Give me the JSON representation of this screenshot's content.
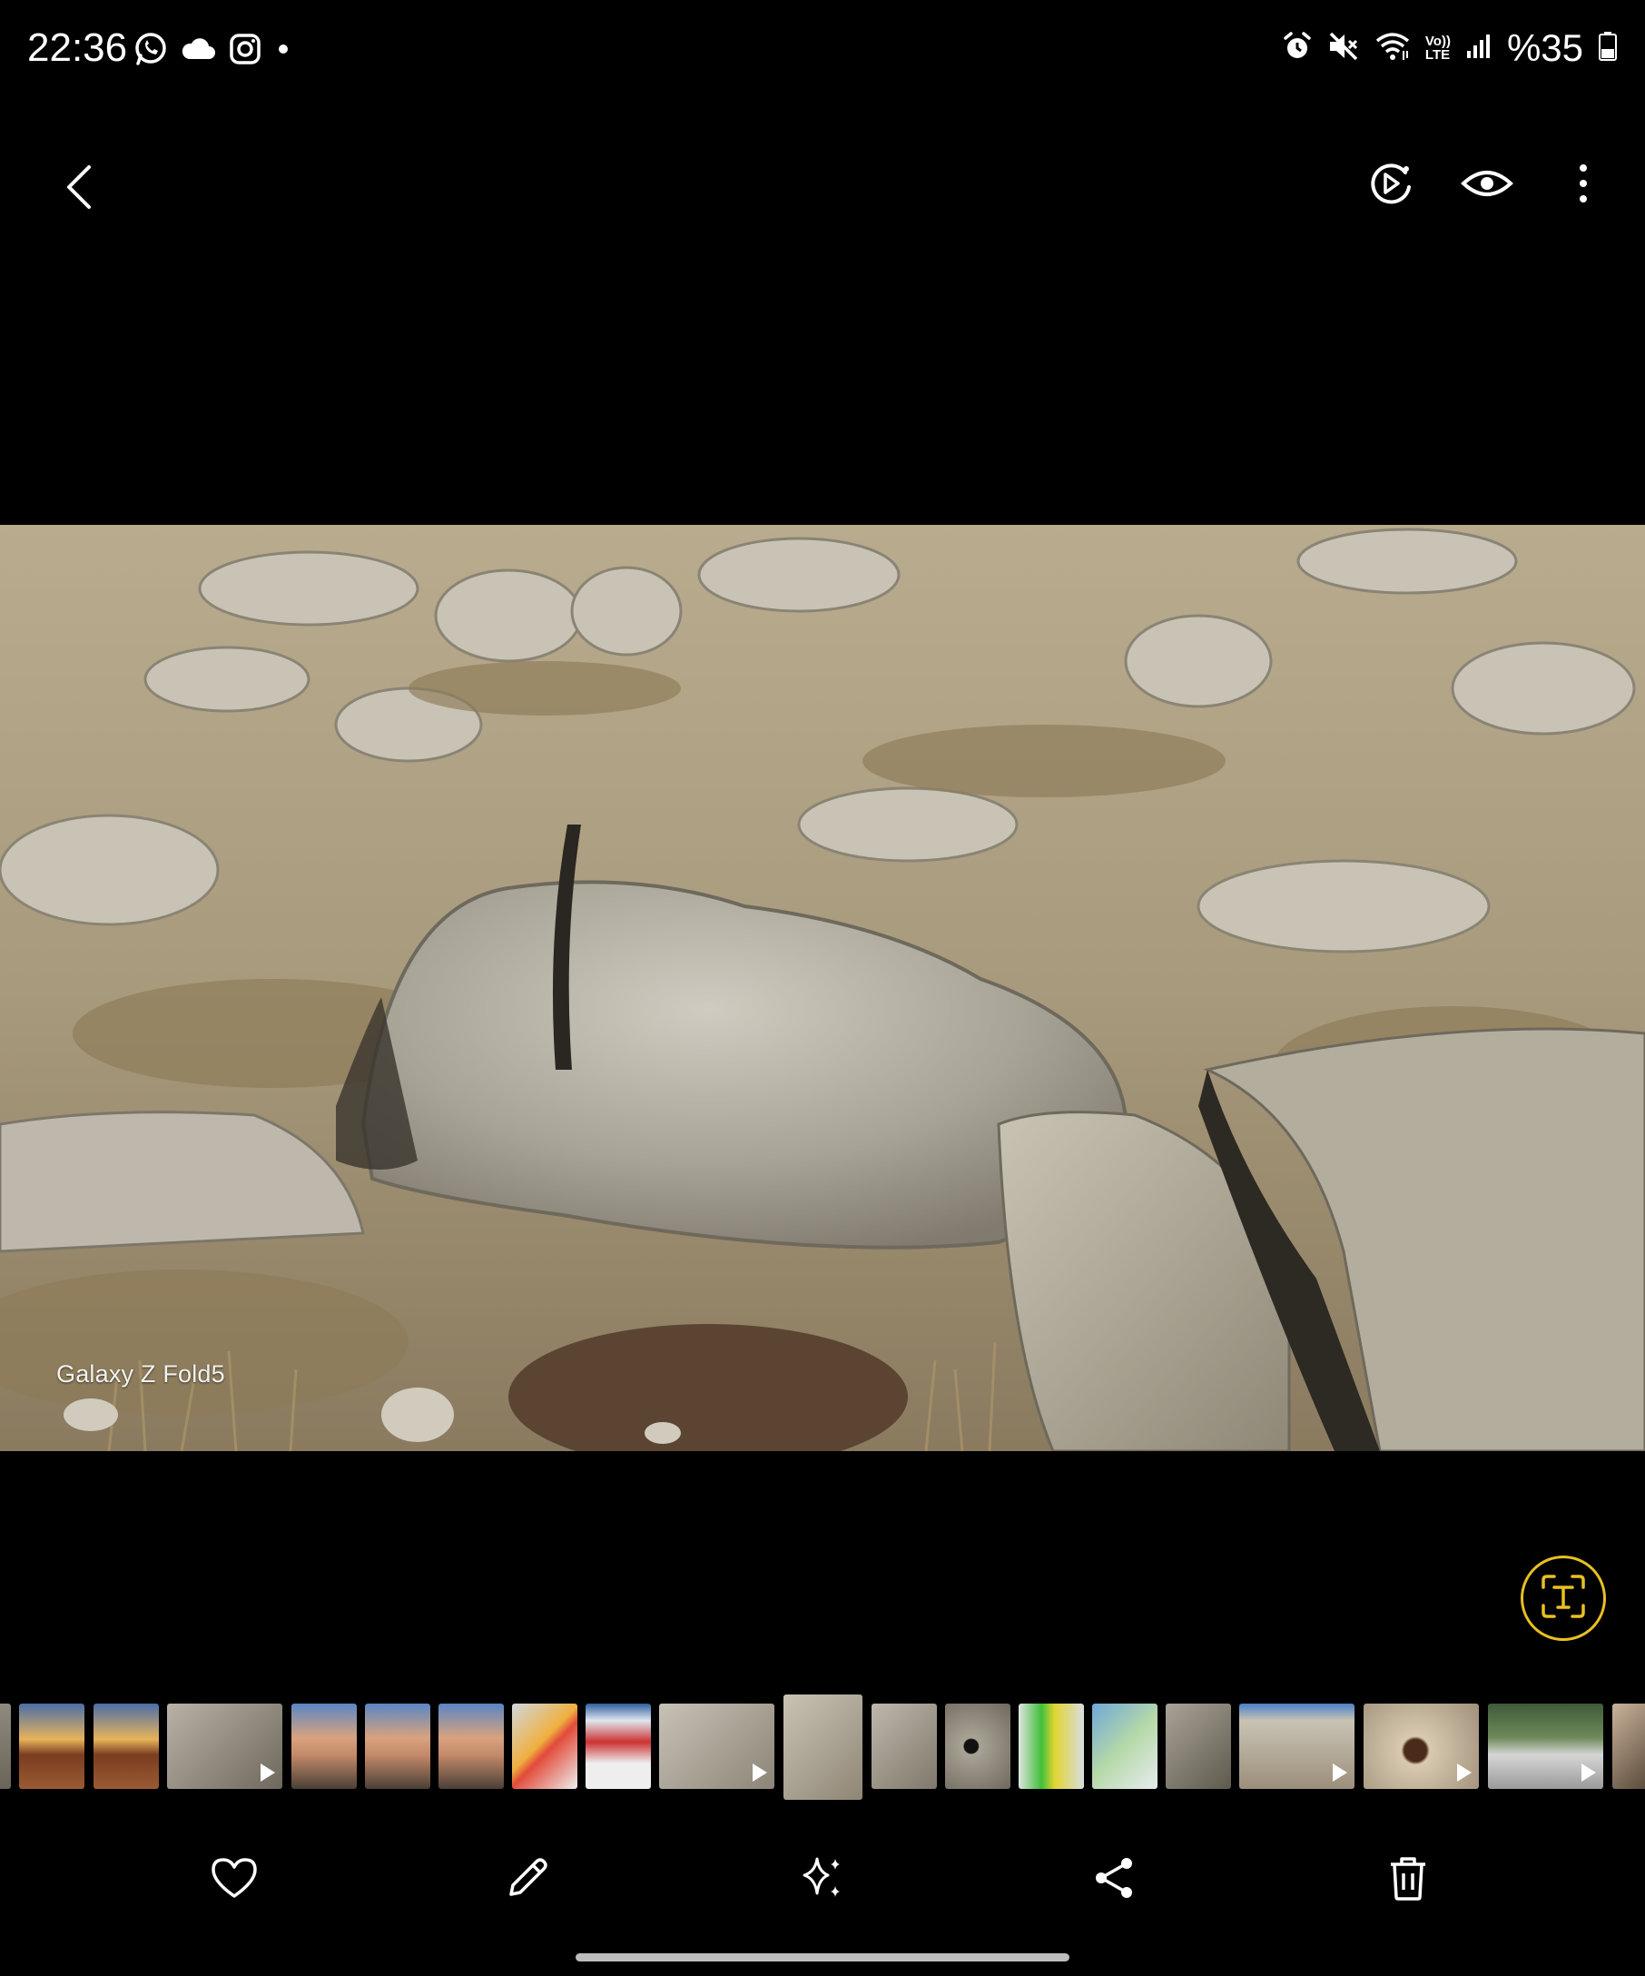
{
  "status_bar": {
    "time": "22:36",
    "battery_text": "%35",
    "left_icons": [
      "whatsapp-icon",
      "cloud-icon",
      "instagram-icon",
      "dot-icon"
    ],
    "right_icons": [
      "alarm-icon",
      "mute-icon",
      "wifi-icon",
      "volte-icon",
      "signal-icon",
      "battery-icon"
    ],
    "volte_label_top": "Vo))",
    "volte_label_bottom": "LTE"
  },
  "top_bar": {
    "actions": [
      "remaster-video-icon",
      "eye-icon",
      "more-vert-icon"
    ]
  },
  "photo": {
    "watermark": "Galaxy Z Fold5"
  },
  "ocr_button": {
    "icon": "text-extract-icon",
    "letter": "T",
    "accent_color": "#e8c021"
  },
  "filmstrip": {
    "thumbnails": [
      {
        "kind": "photo",
        "selected": false
      },
      {
        "kind": "photo",
        "selected": false
      },
      {
        "kind": "photo",
        "selected": false
      },
      {
        "kind": "video",
        "selected": false
      },
      {
        "kind": "photo",
        "selected": false
      },
      {
        "kind": "photo",
        "selected": false
      },
      {
        "kind": "photo",
        "selected": false
      },
      {
        "kind": "photo",
        "selected": false
      },
      {
        "kind": "photo",
        "selected": false
      },
      {
        "kind": "video",
        "selected": false
      },
      {
        "kind": "photo",
        "selected": true
      },
      {
        "kind": "photo",
        "selected": false
      },
      {
        "kind": "photo",
        "selected": false
      },
      {
        "kind": "photo",
        "selected": false
      },
      {
        "kind": "photo",
        "selected": false
      },
      {
        "kind": "photo",
        "selected": false
      },
      {
        "kind": "video",
        "selected": false
      },
      {
        "kind": "video",
        "selected": false
      },
      {
        "kind": "video",
        "selected": false
      },
      {
        "kind": "photo",
        "selected": false
      }
    ]
  },
  "bottom_bar": {
    "actions": [
      "favorite-icon",
      "edit-icon",
      "ai-edit-icon",
      "share-icon",
      "delete-icon"
    ]
  }
}
